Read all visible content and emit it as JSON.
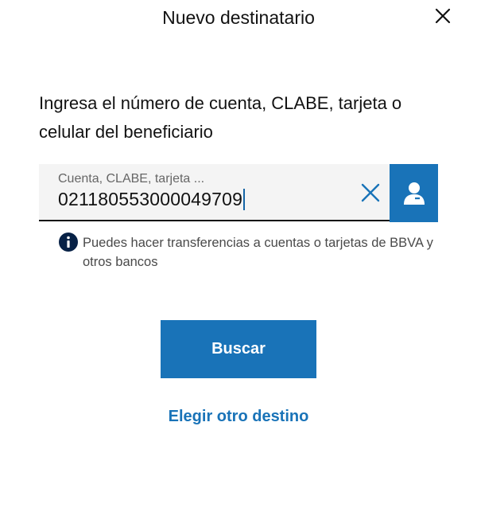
{
  "header": {
    "title": "Nuevo destinatario",
    "close_icon": "close-icon"
  },
  "prompt": {
    "text": "Ingresa el número de cuenta, CLABE, tarjeta o celular del beneficiario"
  },
  "account_field": {
    "label": "Cuenta, CLABE, tarjeta ...",
    "value": "021180553000049709",
    "clear_icon": "close-icon",
    "contact_icon": "person-icon"
  },
  "info": {
    "icon": "info-icon",
    "text": "Puedes hacer transferencias a cuentas o tarjetas de BBVA y otros bancos"
  },
  "actions": {
    "search_label": "Buscar",
    "other_destination_label": "Elegir otro destino"
  },
  "colors": {
    "primary": "#1973b8",
    "info_icon": "#072146",
    "field_bg": "#f4f4f4",
    "text": "#121212"
  }
}
